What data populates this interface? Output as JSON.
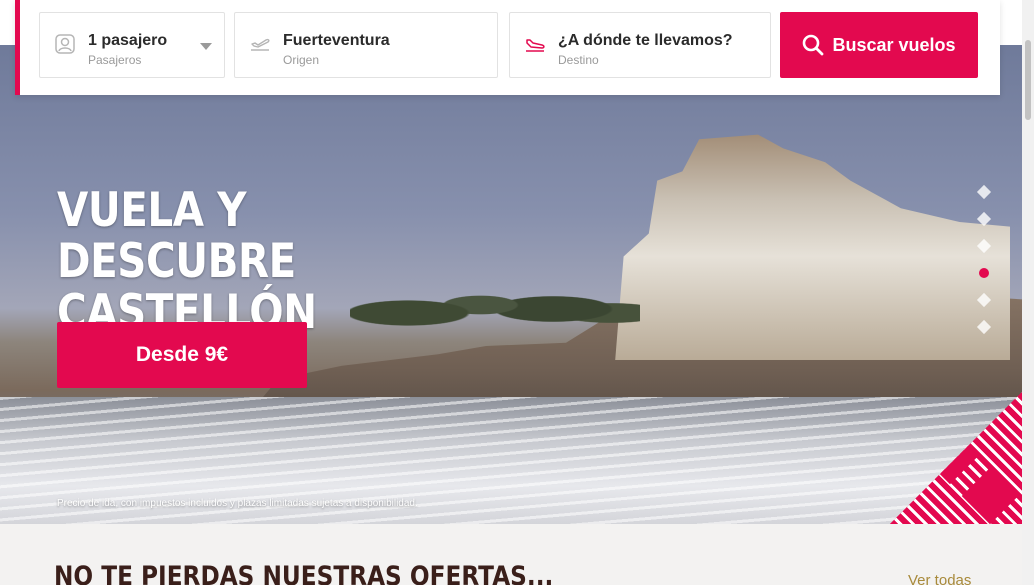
{
  "search": {
    "passengers": {
      "value": "1 pasajero",
      "label": "Pasajeros",
      "icon": "passenger-icon"
    },
    "origin": {
      "value": "Fuerteventura",
      "label": "Origen",
      "icon": "plane-takeoff-icon"
    },
    "destination": {
      "value": "¿A dónde te llevamos?",
      "label": "Destino",
      "icon": "plane-landing-icon"
    },
    "button_label": "Buscar vuelos",
    "button_icon": "search-icon"
  },
  "hero": {
    "title_line1": "VUELA Y DESCUBRE",
    "title_line2": "CASTELLÓN",
    "price_button": "Desde 9€",
    "disclaimer": "Precio de ida, con impuestos incluidos y plazas limitadas sujetas a disponibilidad.",
    "slider": {
      "total": 6,
      "active": 4
    }
  },
  "offers": {
    "title": "NO TE PIERDAS NUESTRAS OFERTAS...",
    "see_all": "Ver todas"
  },
  "colors": {
    "accent": "#e3094f",
    "title_dark": "#3a1f1a",
    "link_gold": "#a88a3b"
  }
}
